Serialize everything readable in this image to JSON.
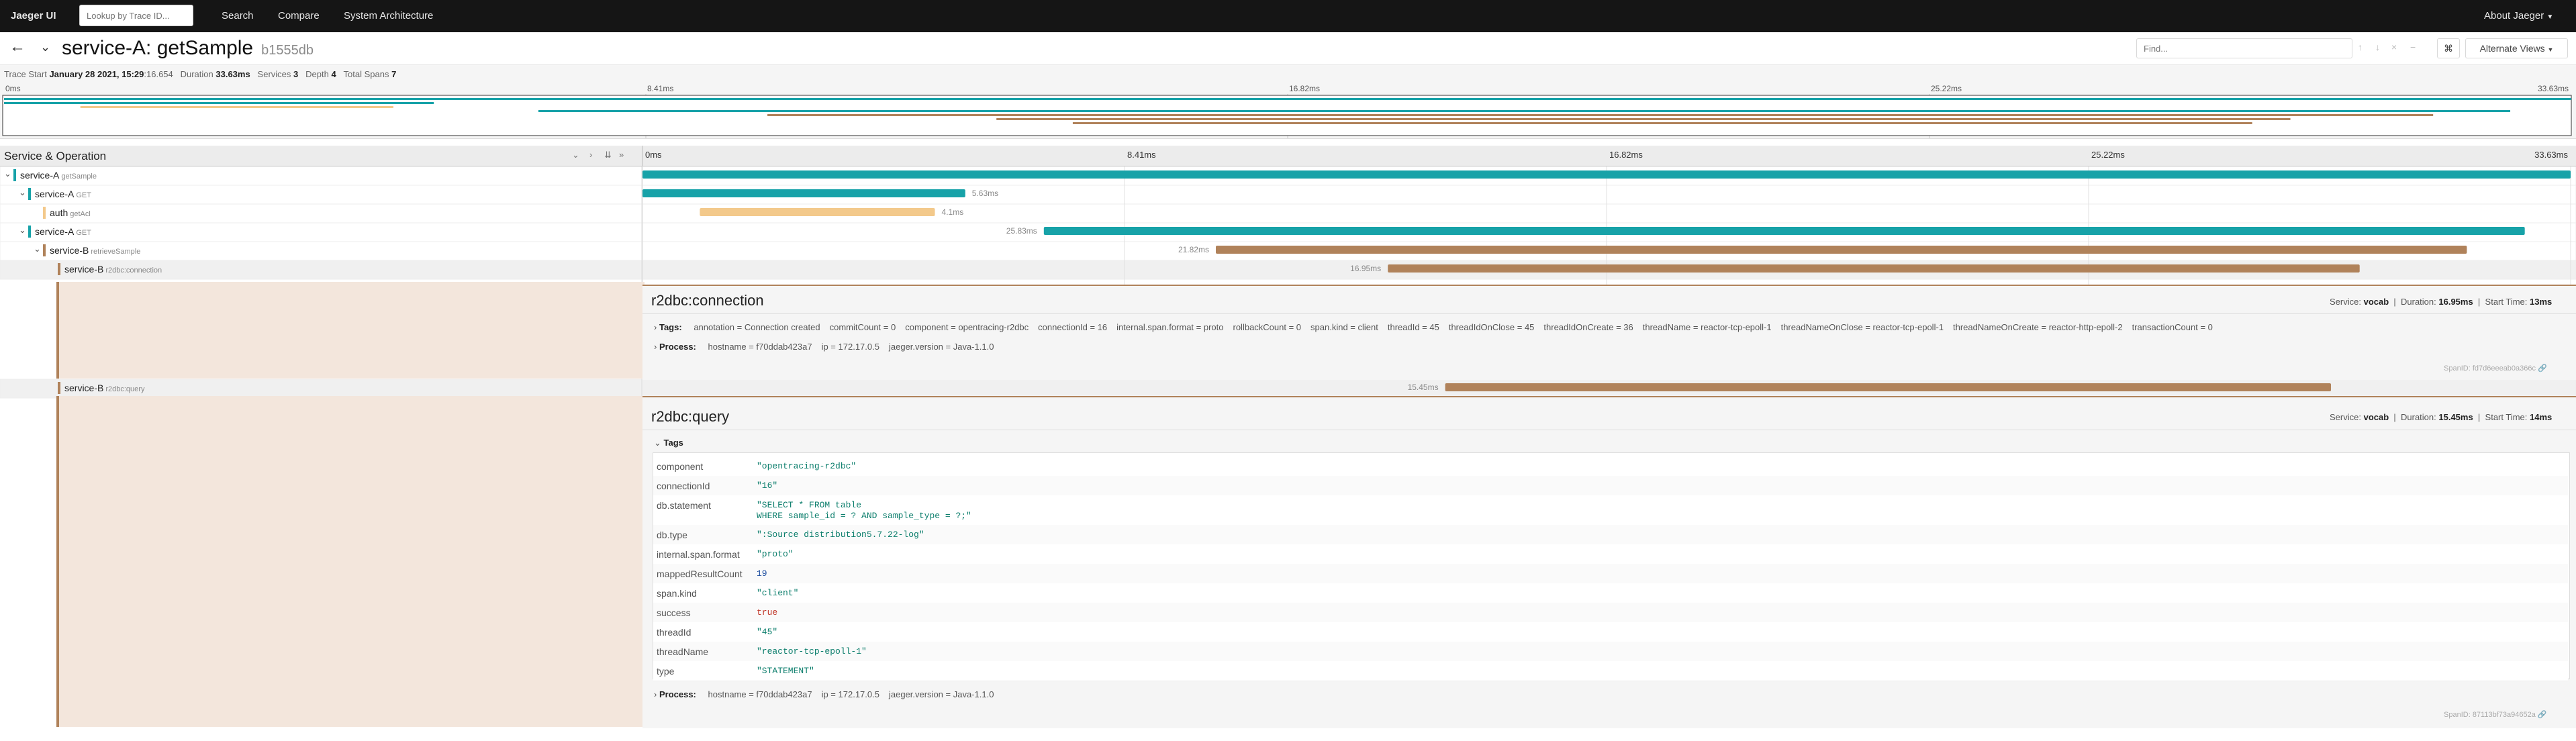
{
  "nav": {
    "brand": "Jaeger UI",
    "lookup_placeholder": "Lookup by Trace ID...",
    "search": "Search",
    "compare": "Compare",
    "system_architecture": "System Architecture",
    "about": "About Jaeger"
  },
  "header": {
    "title": "service-A: getSample",
    "trace_id": "b1555db",
    "find_placeholder": "Find...",
    "alternate_views": "Alternate Views"
  },
  "summary": {
    "trace_start_label": "Trace Start",
    "trace_start_date": "January 28 2021, 15:29",
    "trace_start_ms": ":16.654",
    "duration_label": "Duration",
    "duration": "33.63ms",
    "services_label": "Services",
    "services": "3",
    "depth_label": "Depth",
    "depth": "4",
    "total_spans_label": "Total Spans",
    "total_spans": "7"
  },
  "ticks": [
    "0ms",
    "8.41ms",
    "16.82ms",
    "25.22ms",
    "33.63ms"
  ],
  "colors": {
    "teal": "#17a2a8",
    "orange": "#f3c98b",
    "brown": "#b0825a",
    "pink": "#c97777"
  },
  "trace_duration_ms": 33.63,
  "service_header": "Service & Operation",
  "spans": [
    {
      "service": "service-A",
      "operation": "getSample",
      "start": 0,
      "duration": 33.63,
      "color": "#17a2a8",
      "depth": 0,
      "label": ""
    },
    {
      "service": "service-A",
      "operation": "GET",
      "start": 0,
      "duration": 5.63,
      "color": "#17a2a8",
      "depth": 1,
      "label": "5.63ms"
    },
    {
      "service": "auth",
      "operation": "getAcl",
      "start": 1.0,
      "duration": 4.1,
      "color": "#f3c98b",
      "depth": 2,
      "label": "4.1ms"
    },
    {
      "service": "service-A",
      "operation": "GET",
      "start": 7.0,
      "duration": 25.83,
      "color": "#17a2a8",
      "depth": 1,
      "label": "25.83ms"
    },
    {
      "service": "service-B",
      "operation": "retrieveSample",
      "start": 10.0,
      "duration": 21.82,
      "color": "#b0825a",
      "depth": 2,
      "label": "21.82ms"
    },
    {
      "service": "service-B",
      "operation": "r2dbc:connection",
      "start": 13.0,
      "duration": 16.95,
      "color": "#b0825a",
      "depth": 3,
      "label": "16.95ms"
    },
    {
      "service": "service-B",
      "operation": "r2dbc:query",
      "start": 14.0,
      "duration": 15.45,
      "color": "#b0825a",
      "depth": 3,
      "label": "15.45ms"
    }
  ],
  "detail1": {
    "title": "r2dbc:connection",
    "service_label": "Service:",
    "service": "vocab",
    "duration_label": "Duration:",
    "duration": "16.95ms",
    "start_label": "Start Time:",
    "start": "13ms",
    "tags_label": "Tags:",
    "tags": [
      [
        "annotation",
        "Connection created"
      ],
      [
        "commitCount",
        "0"
      ],
      [
        "component",
        "opentracing-r2dbc"
      ],
      [
        "connectionId",
        "16"
      ],
      [
        "internal.span.format",
        "proto"
      ],
      [
        "rollbackCount",
        "0"
      ],
      [
        "span.kind",
        "client"
      ],
      [
        "threadId",
        "45"
      ],
      [
        "threadIdOnClose",
        "45"
      ],
      [
        "threadIdOnCreate",
        "36"
      ],
      [
        "threadName",
        "reactor-tcp-epoll-1"
      ],
      [
        "threadNameOnClose",
        "reactor-tcp-epoll-1"
      ],
      [
        "threadNameOnCreate",
        "reactor-http-epoll-2"
      ],
      [
        "transactionCount",
        "0"
      ]
    ],
    "process_label": "Process:",
    "process": [
      [
        "hostname",
        "f70ddab423a7"
      ],
      [
        "ip",
        "172.17.0.5"
      ],
      [
        "jaeger.version",
        "Java-1.1.0"
      ]
    ],
    "span_id_label": "SpanID:",
    "span_id": "fd7d6eeeab0a366c"
  },
  "detail2": {
    "title": "r2dbc:query",
    "service_label": "Service:",
    "service": "vocab",
    "duration_label": "Duration:",
    "duration": "15.45ms",
    "start_label": "Start Time:",
    "start": "14ms",
    "tags_label": "Tags",
    "tags": [
      {
        "key": "component",
        "value": "\"opentracing-r2dbc\"",
        "kind": "str"
      },
      {
        "key": "connectionId",
        "value": "\"16\"",
        "kind": "str"
      },
      {
        "key": "db.statement",
        "value": "\"SELECT * FROM table\nWHERE sample_id = ? AND sample_type = ?;\"",
        "kind": "str"
      },
      {
        "key": "db.type",
        "value": "\":Source distribution5.7.22-log\"",
        "kind": "str"
      },
      {
        "key": "internal.span.format",
        "value": "\"proto\"",
        "kind": "str"
      },
      {
        "key": "mappedResultCount",
        "value": "19",
        "kind": "num"
      },
      {
        "key": "span.kind",
        "value": "\"client\"",
        "kind": "str"
      },
      {
        "key": "success",
        "value": "true",
        "kind": "bool"
      },
      {
        "key": "threadId",
        "value": "\"45\"",
        "kind": "str"
      },
      {
        "key": "threadName",
        "value": "\"reactor-tcp-epoll-1\"",
        "kind": "str"
      },
      {
        "key": "type",
        "value": "\"STATEMENT\"",
        "kind": "str"
      }
    ],
    "process_label": "Process:",
    "process": [
      [
        "hostname",
        "f70ddab423a7"
      ],
      [
        "ip",
        "172.17.0.5"
      ],
      [
        "jaeger.version",
        "Java-1.1.0"
      ]
    ],
    "span_id_label": "SpanID:",
    "span_id": "87113bf73a94652a"
  }
}
